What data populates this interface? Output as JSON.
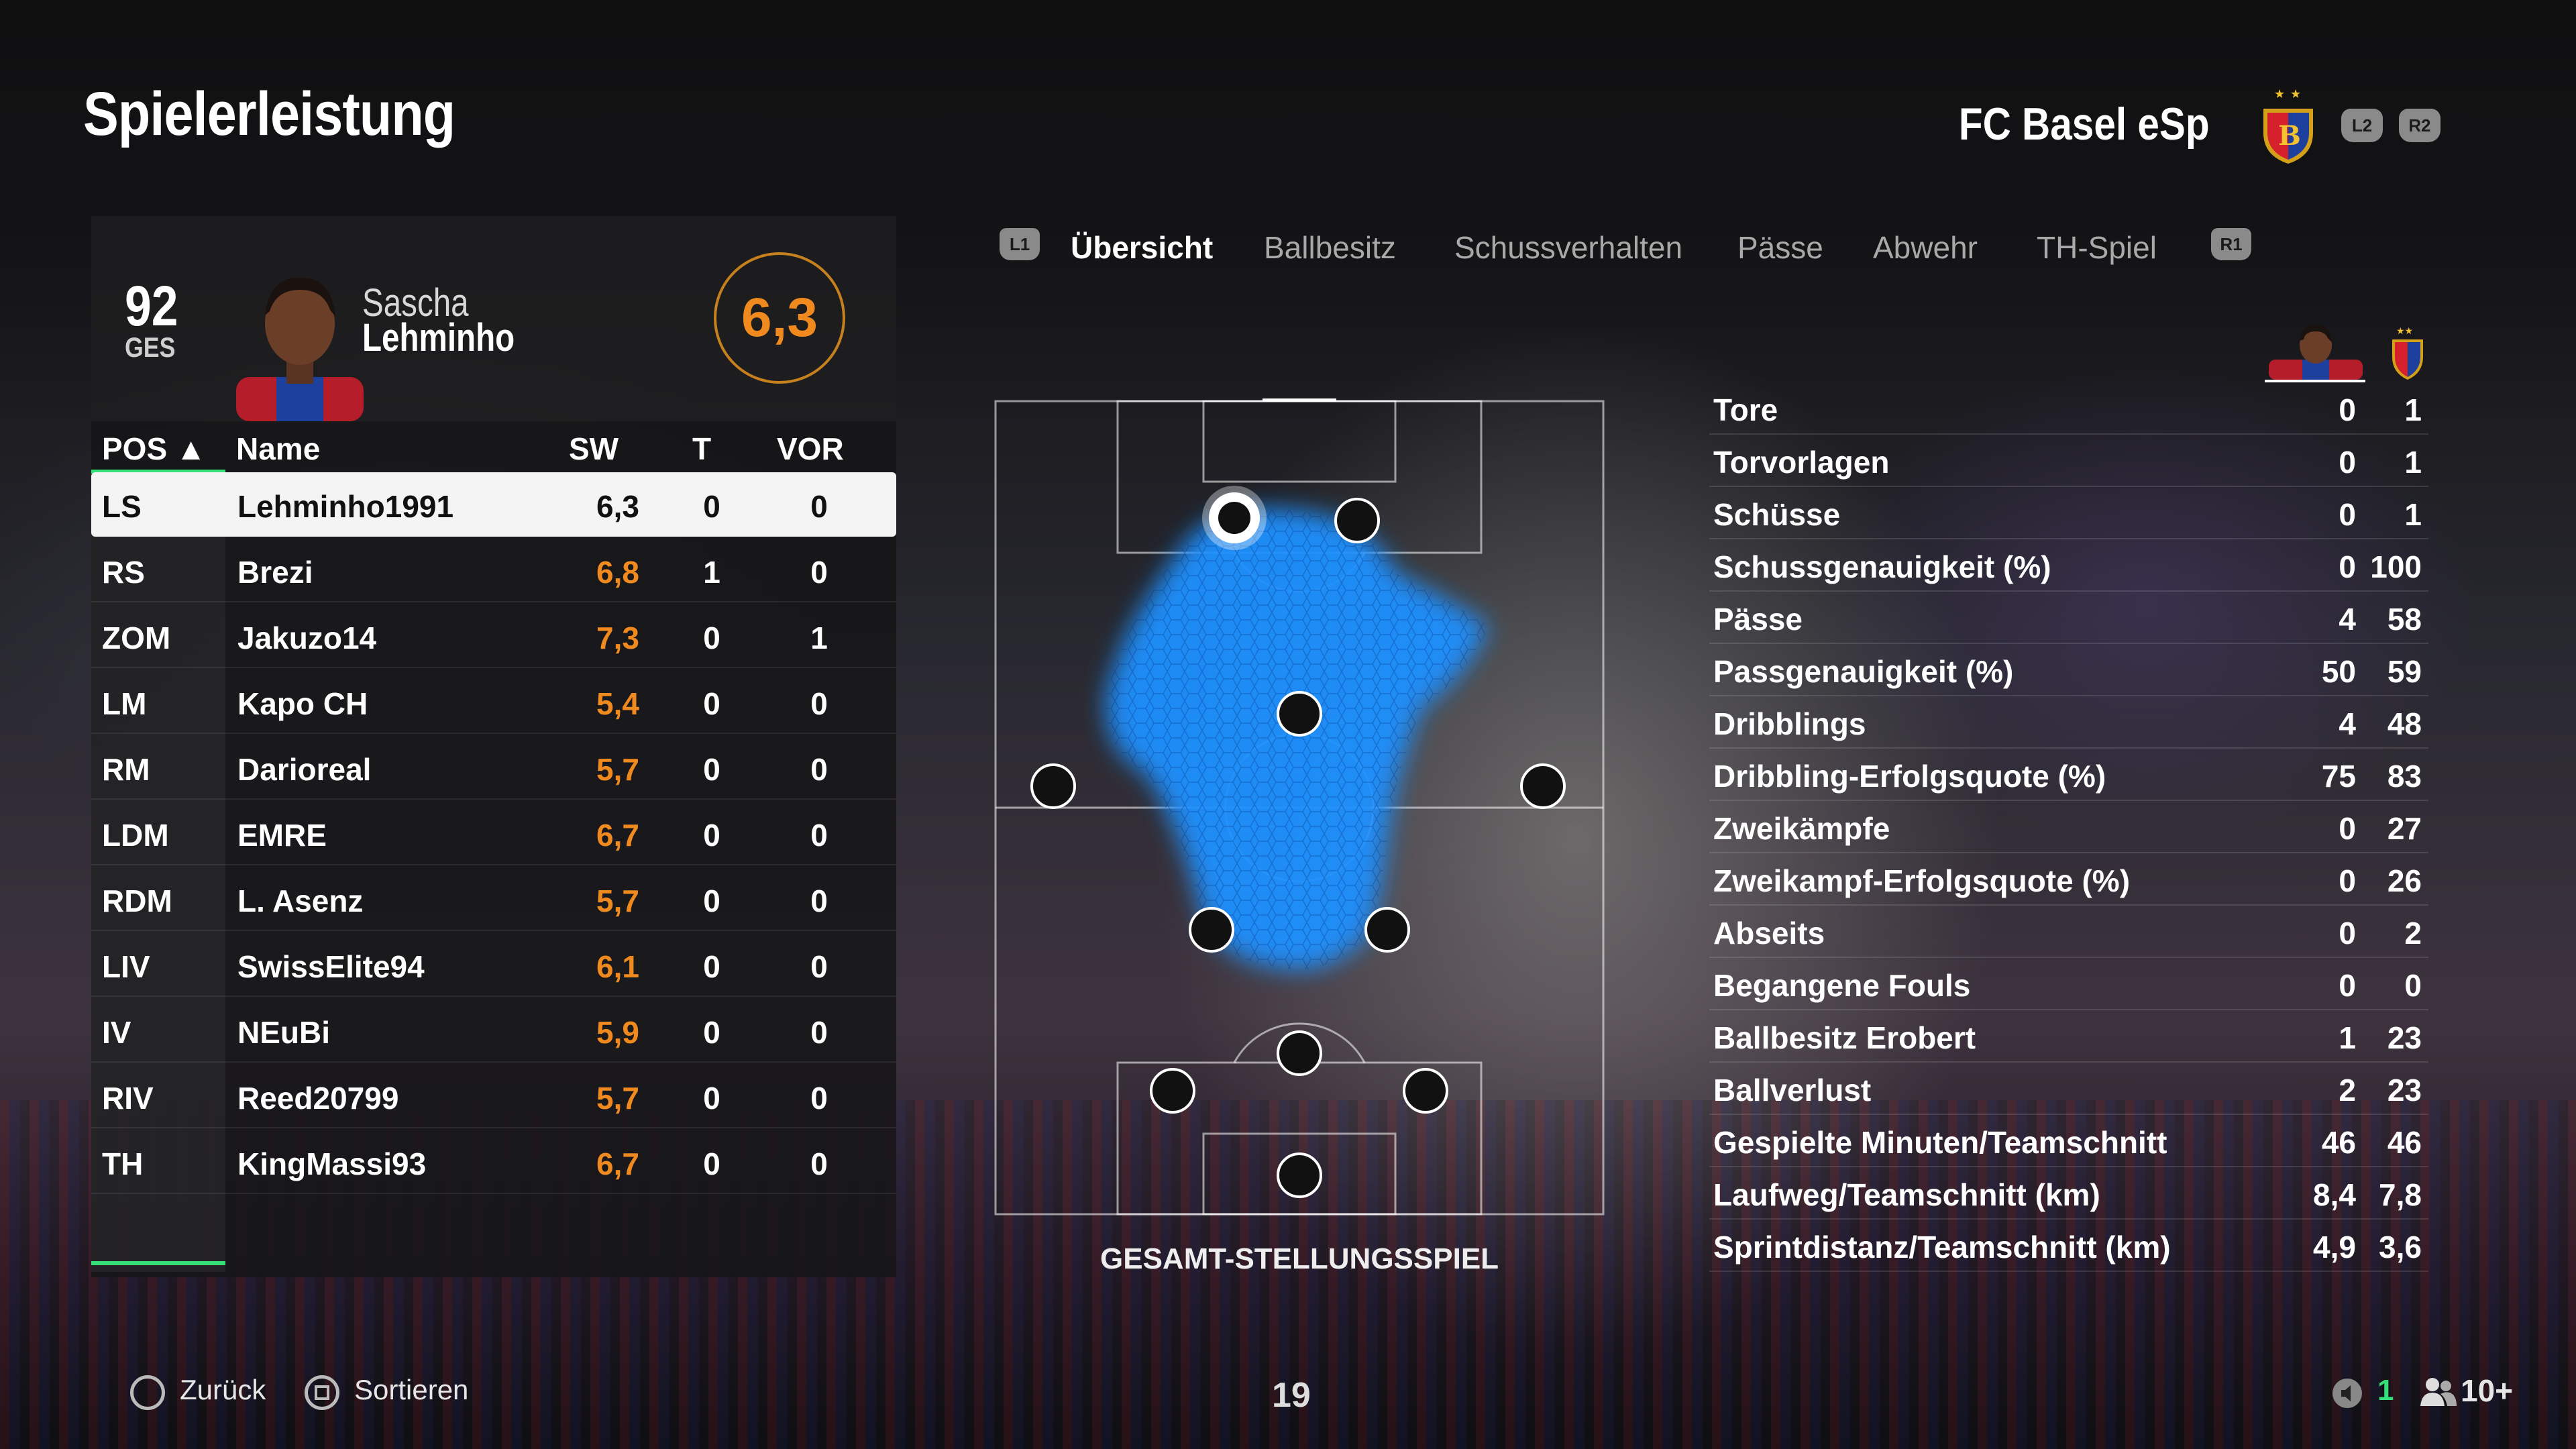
{
  "page": {
    "title": "Spielerleistung",
    "club_name": "FC Basel eSp",
    "page_number": "19"
  },
  "header_buttons": {
    "l2": "L2",
    "r2": "R2"
  },
  "player_card": {
    "overall": "92",
    "overall_label": "GES",
    "first_name": "Sascha",
    "last_name": "Lehminho",
    "rating": "6,3"
  },
  "table": {
    "headers": {
      "pos": "POS ▲",
      "name": "Name",
      "sw": "SW",
      "t": "T",
      "vor": "VOR"
    },
    "rows": [
      {
        "pos": "LS",
        "name": "Lehminho1991",
        "sw": "6,3",
        "t": "0",
        "vor": "0"
      },
      {
        "pos": "RS",
        "name": "Brezi",
        "sw": "6,8",
        "t": "1",
        "vor": "0"
      },
      {
        "pos": "ZOM",
        "name": "Jakuzo14",
        "sw": "7,3",
        "t": "0",
        "vor": "1"
      },
      {
        "pos": "LM",
        "name": "Kapo CH",
        "sw": "5,4",
        "t": "0",
        "vor": "0"
      },
      {
        "pos": "RM",
        "name": "Darioreal",
        "sw": "5,7",
        "t": "0",
        "vor": "0"
      },
      {
        "pos": "LDM",
        "name": "EMRE",
        "sw": "6,7",
        "t": "0",
        "vor": "0"
      },
      {
        "pos": "RDM",
        "name": "L. Asenz",
        "sw": "5,7",
        "t": "0",
        "vor": "0"
      },
      {
        "pos": "LIV",
        "name": "SwissElite94",
        "sw": "6,1",
        "t": "0",
        "vor": "0"
      },
      {
        "pos": "IV",
        "name": "NEuBi",
        "sw": "5,9",
        "t": "0",
        "vor": "0"
      },
      {
        "pos": "RIV",
        "name": "Reed20799",
        "sw": "5,7",
        "t": "0",
        "vor": "0"
      },
      {
        "pos": "TH",
        "name": "KingMassi93",
        "sw": "6,7",
        "t": "0",
        "vor": "0"
      }
    ]
  },
  "tabs": {
    "l1": "L1",
    "r1": "R1",
    "items": [
      "Übersicht",
      "Ballbesitz",
      "Schussverhalten",
      "Pässe",
      "Abwehr",
      "TH-Spiel"
    ]
  },
  "pitch": {
    "label": "GESAMT-STELLUNGSSPIEL"
  },
  "stats": [
    {
      "label": "Tore",
      "player": "0",
      "team": "1"
    },
    {
      "label": "Torvorlagen",
      "player": "0",
      "team": "1"
    },
    {
      "label": "Schüsse",
      "player": "0",
      "team": "1"
    },
    {
      "label": "Schussgenauigkeit (%)",
      "player": "0",
      "team": "100"
    },
    {
      "label": "Pässe",
      "player": "4",
      "team": "58"
    },
    {
      "label": "Passgenauigkeit (%)",
      "player": "50",
      "team": "59"
    },
    {
      "label": "Dribblings",
      "player": "4",
      "team": "48"
    },
    {
      "label": "Dribbling-Erfolgsquote (%)",
      "player": "75",
      "team": "83"
    },
    {
      "label": "Zweikämpfe",
      "player": "0",
      "team": "27"
    },
    {
      "label": "Zweikampf-Erfolgsquote (%)",
      "player": "0",
      "team": "26"
    },
    {
      "label": "Abseits",
      "player": "0",
      "team": "2"
    },
    {
      "label": "Begangene Fouls",
      "player": "0",
      "team": "0"
    },
    {
      "label": "Ballbesitz Erobert",
      "player": "1",
      "team": "23"
    },
    {
      "label": "Ballverlust",
      "player": "2",
      "team": "23"
    },
    {
      "label": "Gespielte Minuten/Teamschnitt",
      "player": "46",
      "team": "46"
    },
    {
      "label": "Laufweg/Teamschnitt (km)",
      "player": "8,4",
      "team": "7,8"
    },
    {
      "label": "Sprintdistanz/Teamschnitt (km)",
      "player": "4,9",
      "team": "3,6"
    }
  ],
  "footer": {
    "back_label": "Zurück",
    "sort_label": "Sortieren",
    "online_count": "1",
    "users_count": "10+"
  },
  "colors": {
    "accent_green": "#35e07a",
    "rating_orange": "#f08a1e",
    "heatmap_blue": "#1e90ff"
  }
}
